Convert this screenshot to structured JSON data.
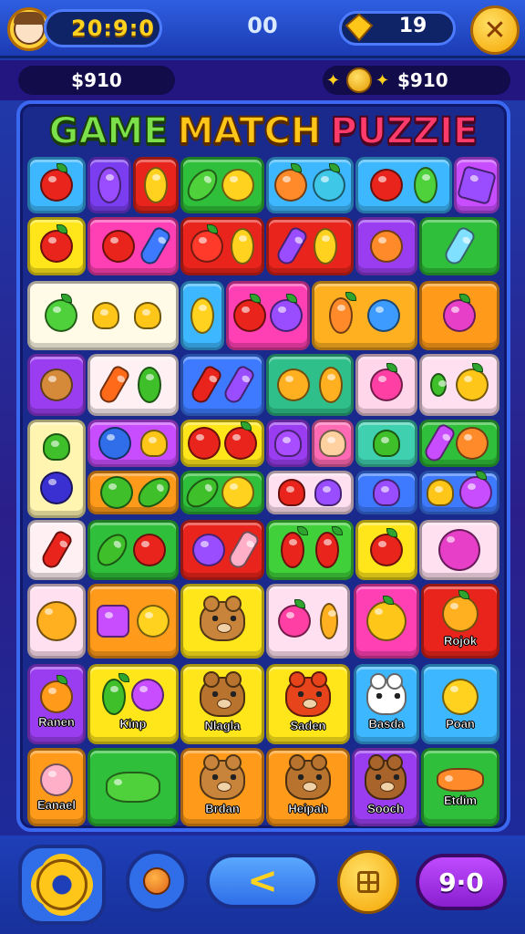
{
  "hud": {
    "timer": "20:9:0",
    "center_count": "00",
    "gems": "19",
    "close_symbol": "✕"
  },
  "money": {
    "left": "$910",
    "right": "$910"
  },
  "title": {
    "part1": "GAME",
    "part2": "MATCH",
    "part3": "PUZZIE"
  },
  "colors": {
    "accent_blue": "#2f6ee8",
    "gold": "#ffc61a",
    "red": "#ff3b6b",
    "green": "#7be04a"
  },
  "labels": {
    "r7c6": "Rojok",
    "r8c1": "Ranen",
    "r8c2": "Kinp",
    "r8c3": "Nlagla",
    "r8c4": "Saden",
    "r8c5": "Basda",
    "r8c6": "Poan",
    "r9c1": "Eanael",
    "r9c3": "Brdan",
    "r9c4": "Heipah",
    "r9c5": "Sooch",
    "r9c6": "Etdim"
  },
  "bottom": {
    "back_symbol": "<",
    "score": "9·0"
  }
}
